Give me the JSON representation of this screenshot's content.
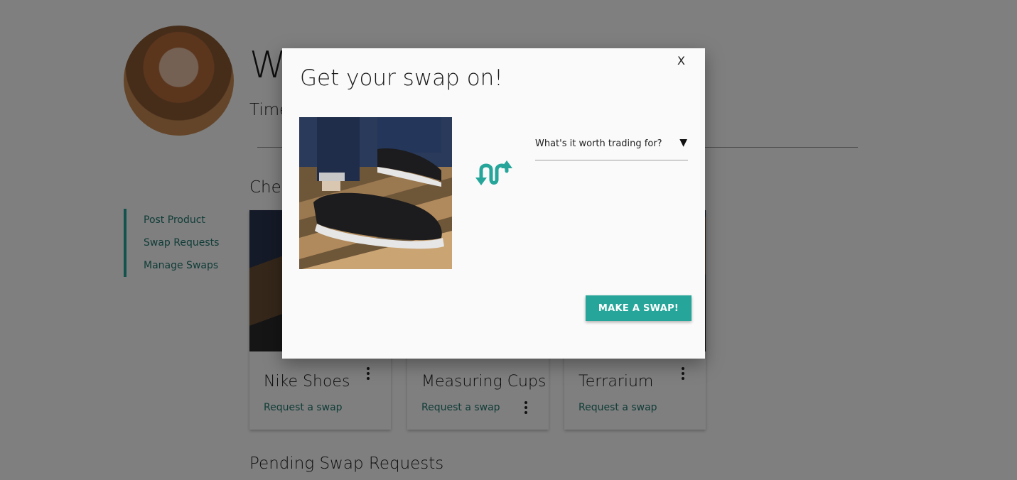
{
  "header": {
    "welcome": "We",
    "subtitle": "Time"
  },
  "sidebar": {
    "items": [
      {
        "label": "Post Product"
      },
      {
        "label": "Swap Requests"
      },
      {
        "label": "Manage Swaps"
      }
    ]
  },
  "main": {
    "section_title": "Chec",
    "cards": [
      {
        "name": "Nike Shoes",
        "action": "Request a swap"
      },
      {
        "name": "Measuring Cups",
        "action": "Request a swap"
      },
      {
        "name": "Terrarium",
        "action": "Request a swap"
      }
    ],
    "pending_title": "Pending Swap Requests"
  },
  "modal": {
    "close_label": "X",
    "title": "Get your swap on!",
    "select_placeholder": "What's it worth trading for?",
    "caret": "▼",
    "button_label": "MAKE A SWAP!"
  },
  "colors": {
    "accent": "#26a69a",
    "link": "#20796f",
    "overlay": "rgba(0,0,0,0.5)"
  },
  "icons": [
    "swap-arrows-icon",
    "more-vert-icon",
    "dropdown-caret-icon"
  ]
}
